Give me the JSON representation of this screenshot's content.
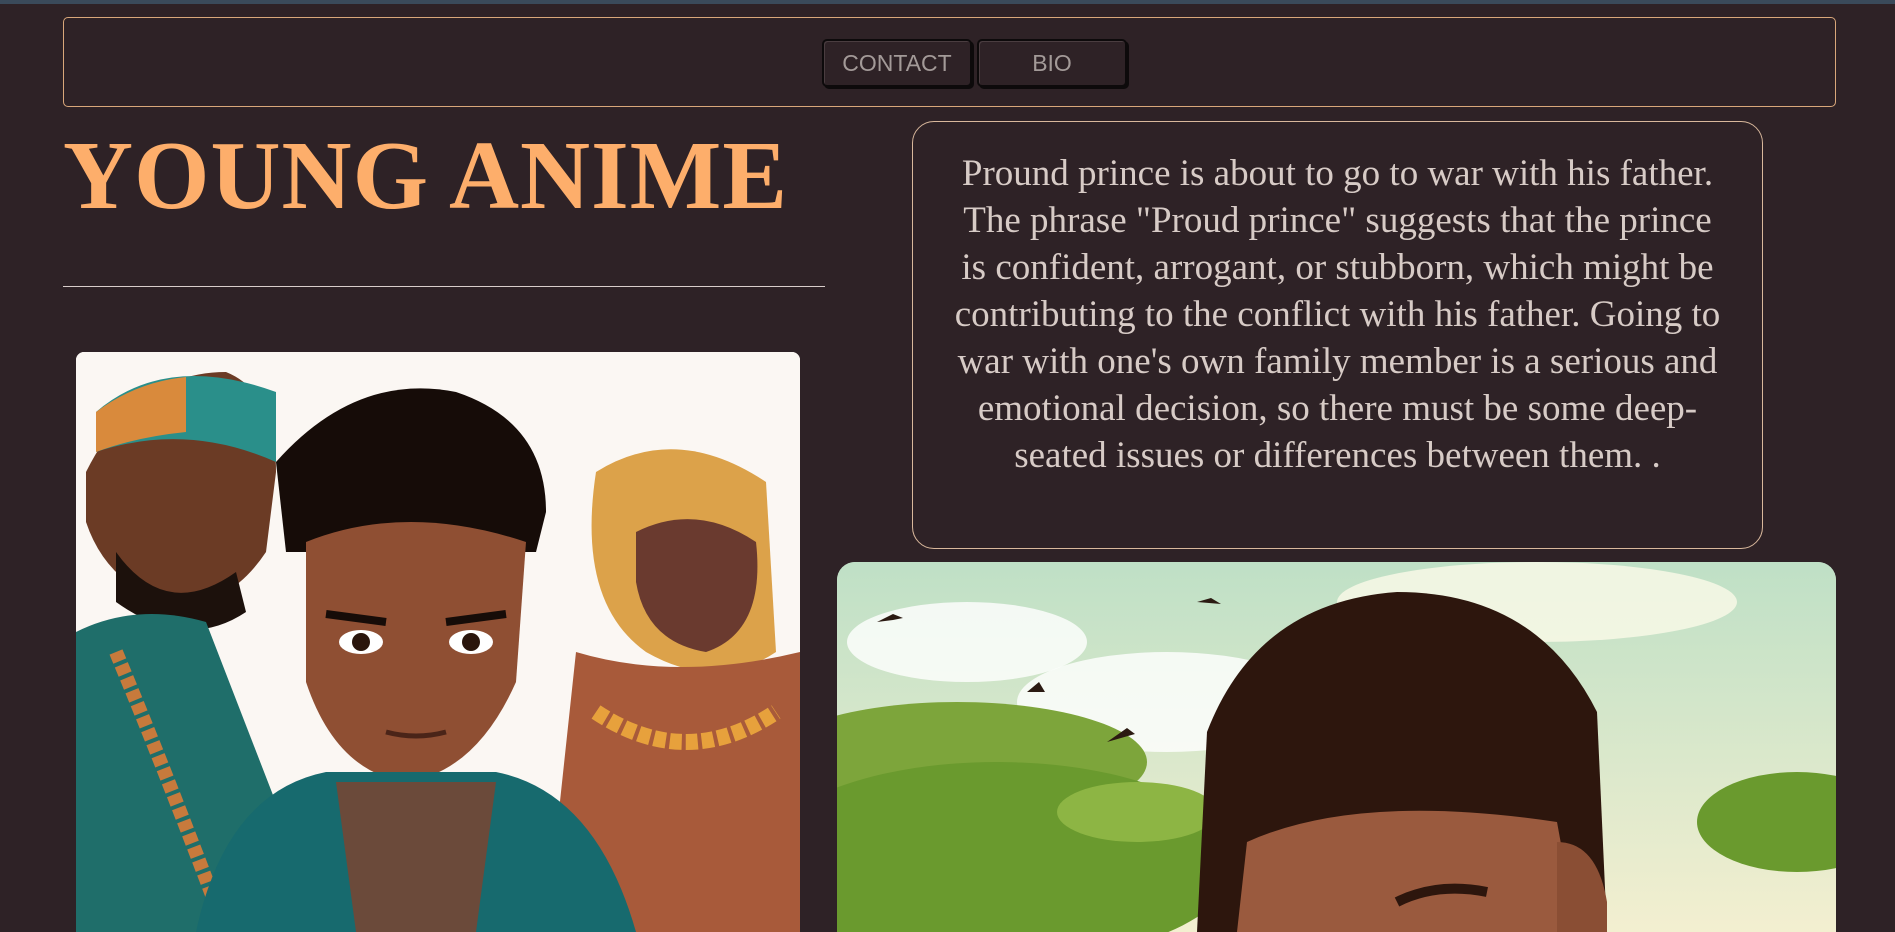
{
  "nav": {
    "contact_label": "CONTACT",
    "bio_label": "BIO"
  },
  "hero": {
    "title": "YOUNG ANIME"
  },
  "description": {
    "text": "Pround prince is about to go to war with his father. The phrase \"Proud prince\" suggests that the prince is confident, arrogant, or stubborn, which might be contributing to the conflict with his father. Going to war with one's own family member is a serious and emotional decision, so there must be some deep-seated issues or differences between them. ."
  },
  "colors": {
    "background": "#2e2226",
    "accent": "#fdae6b",
    "border": "#d9a77a",
    "text": "#d7cbc6"
  },
  "images": {
    "family_portrait": "family-illustration",
    "savanna_boy": "savanna-boy-illustration"
  }
}
